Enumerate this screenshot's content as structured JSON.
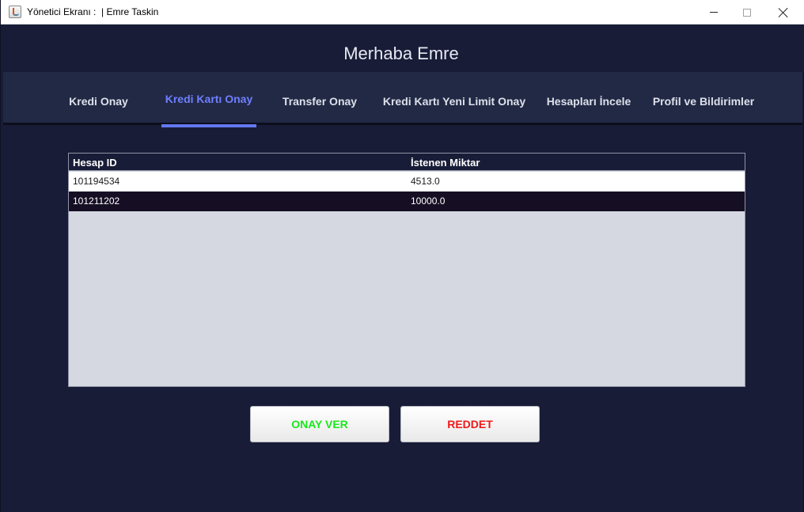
{
  "window": {
    "title": "Yönetici Ekranı :  | Emre Taskin"
  },
  "header": {
    "greeting": "Merhaba Emre"
  },
  "tabs": [
    {
      "label": "Kredi Onay",
      "active": false
    },
    {
      "label": "Kredi Kartı Onay",
      "active": true
    },
    {
      "label": "Transfer Onay",
      "active": false
    },
    {
      "label": "Kredi Kartı Yeni Limit Onay",
      "active": false
    },
    {
      "label": "Hesapları İncele",
      "active": false
    },
    {
      "label": "Profil ve Bildirimler",
      "active": false
    }
  ],
  "table": {
    "columns": [
      "Hesap ID",
      "İstenen Miktar"
    ],
    "rows": [
      [
        "101194534",
        "4513.0"
      ],
      [
        "101211202",
        "10000.0"
      ]
    ],
    "selected_row": 1
  },
  "actions": {
    "approve_label": "ONAY VER",
    "reject_label": "REDDET"
  },
  "colors": {
    "background": "#181c37",
    "tab_bar": "#212945",
    "active_tab": "#6f7fff",
    "approve_text": "#19e81b",
    "reject_text": "#ee1a1a"
  }
}
